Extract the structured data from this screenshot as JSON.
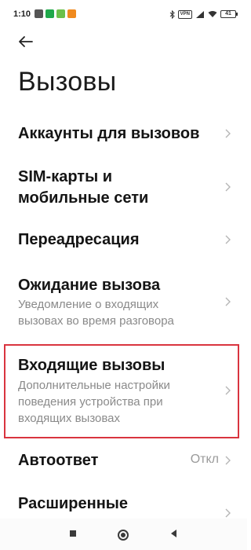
{
  "status_bar": {
    "time": "1:10",
    "app_icons": [
      {
        "name": "theme-icon",
        "color": "#555555"
      },
      {
        "name": "app-green-icon",
        "color": "#1fa84a"
      },
      {
        "name": "app-lightgreen-icon",
        "color": "#6cc04a"
      },
      {
        "name": "app-orange-icon",
        "color": "#f08a1e"
      }
    ],
    "vpn_label": "VPN",
    "battery": "41"
  },
  "header": {
    "back_icon": "arrow-left-icon",
    "title": "Вызовы"
  },
  "settings": {
    "accounts": {
      "title": "Аккаунты для вызовов"
    },
    "sim": {
      "title_line1": "SIM-карты и",
      "title_line2": "мобильные сети"
    },
    "forwarding": {
      "title": "Переадресация"
    },
    "waiting": {
      "title": "Ожидание вызова",
      "subtitle_line1": "Уведомление о входящих",
      "subtitle_line2": "вызовах во время разговора"
    },
    "incoming": {
      "title": "Входящие вызовы",
      "subtitle_line1": "Дополнительные настройки",
      "subtitle_line2": "поведения устройства при",
      "subtitle_line3": "входящих вызовах"
    },
    "autoanswer": {
      "title": "Автоответ",
      "value": "Откл"
    },
    "advanced": {
      "title": "Расширенные"
    }
  },
  "colors": {
    "highlight": "#d9343f",
    "chevron": "#b5b5b5"
  },
  "nav_bar": {
    "icons": [
      "recents-square-icon",
      "home-circle-icon",
      "back-triangle-icon"
    ]
  }
}
